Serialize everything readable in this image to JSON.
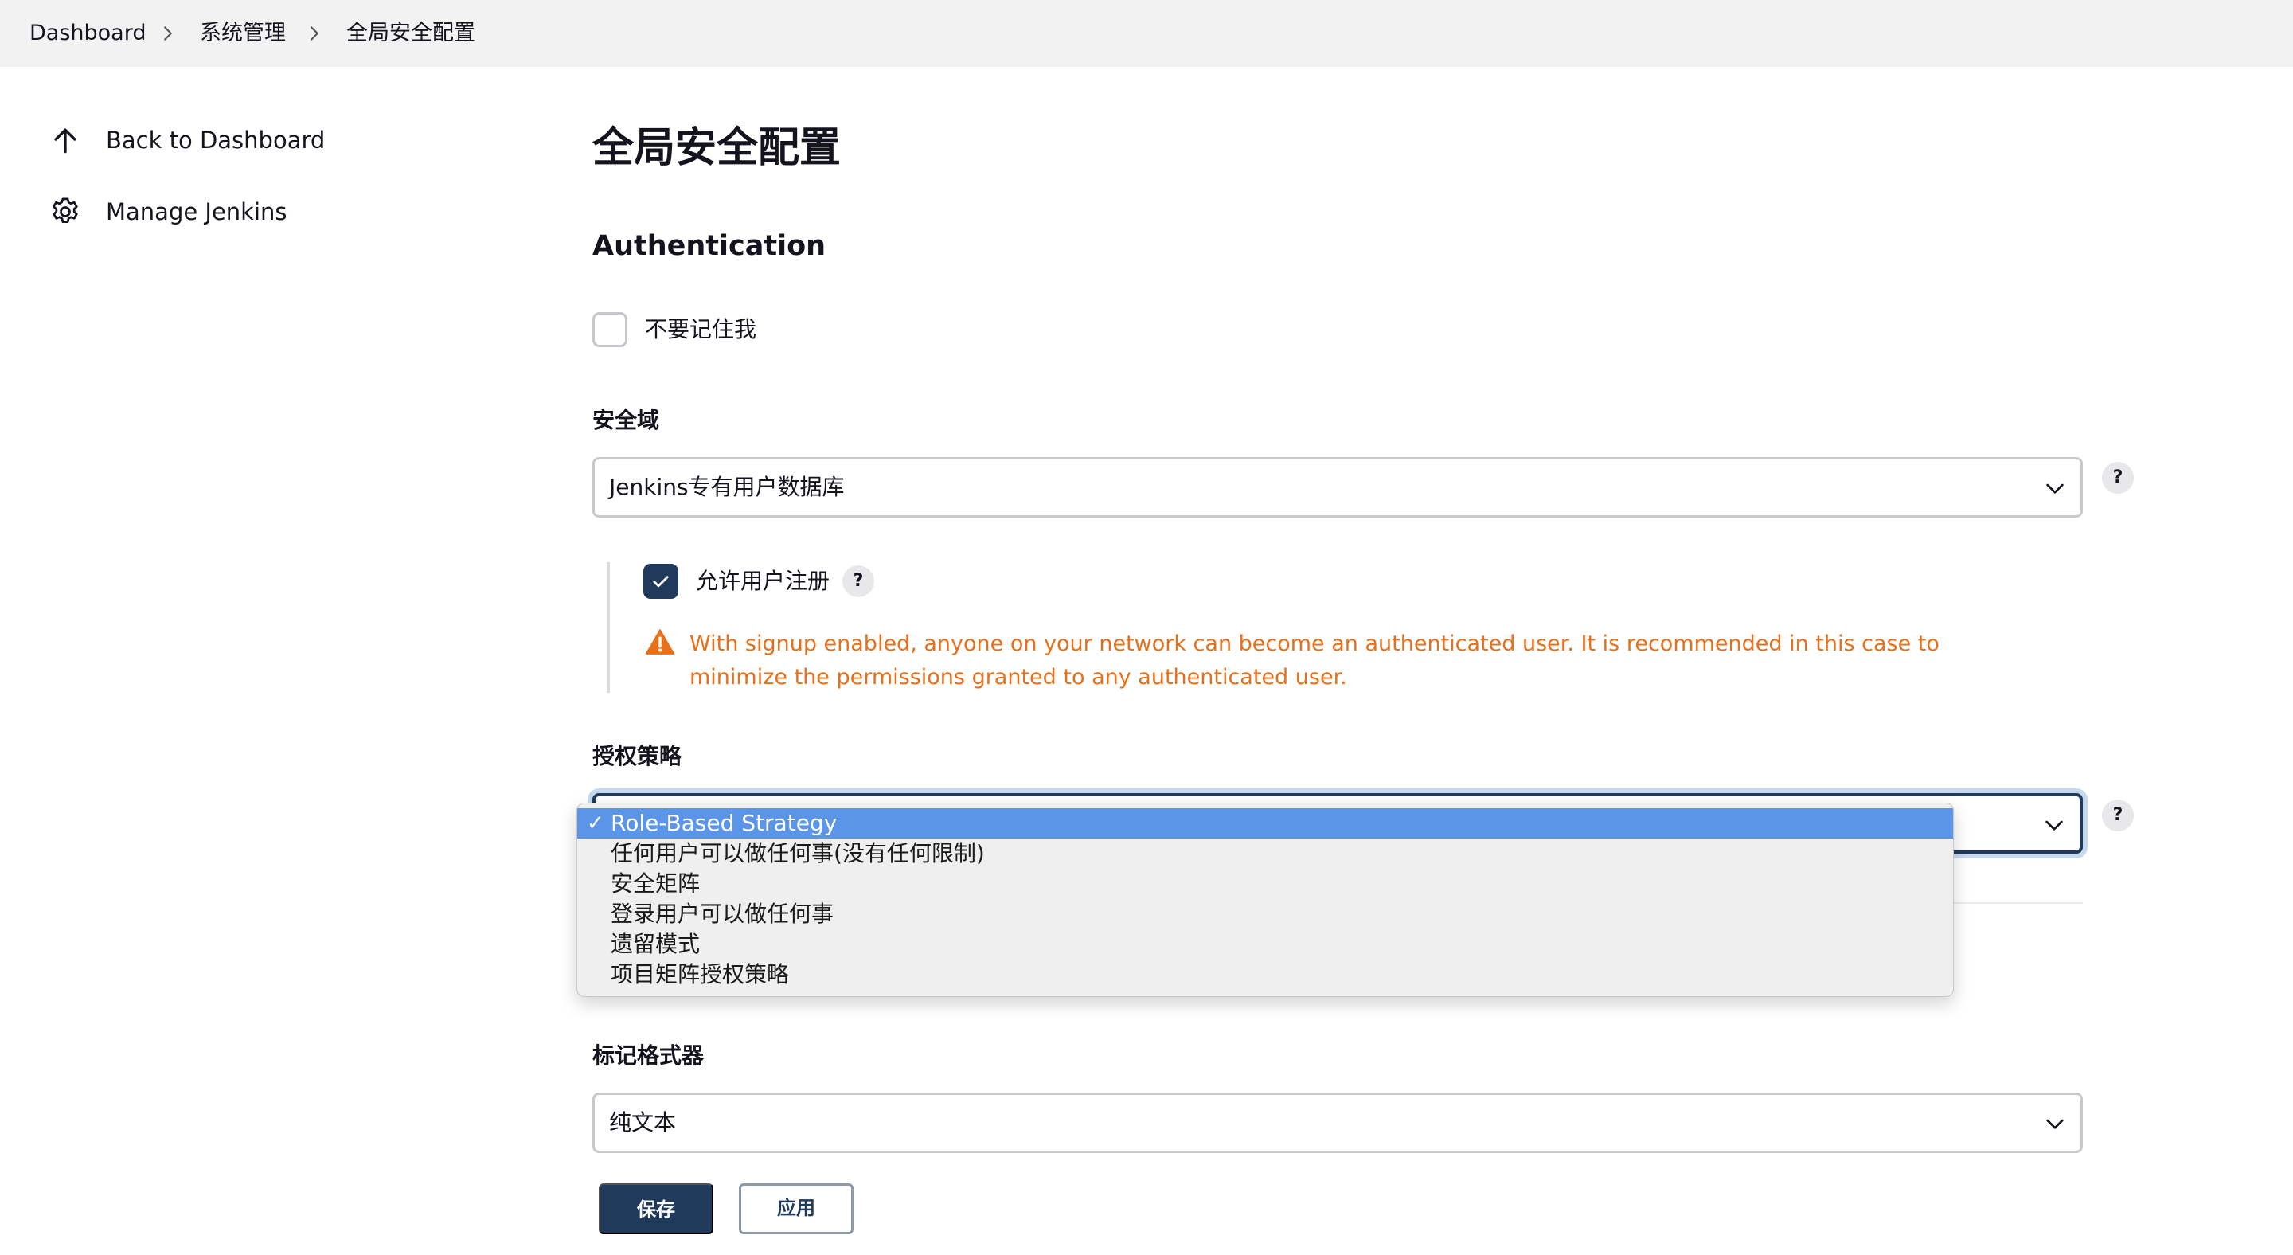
{
  "breadcrumb": {
    "items": [
      "Dashboard",
      "系统管理",
      "全局安全配置"
    ]
  },
  "sidebar": {
    "items": [
      {
        "label": "Back to Dashboard",
        "icon": "arrow-up-icon"
      },
      {
        "label": "Manage Jenkins",
        "icon": "gear-icon"
      }
    ]
  },
  "page": {
    "title": "全局安全配置",
    "section_title": "Authentication"
  },
  "remember_me": {
    "label": "不要记住我",
    "checked": false
  },
  "security_realm": {
    "label": "安全域",
    "value": "Jenkins专有用户数据库",
    "help": "?"
  },
  "allow_signup": {
    "label": "允许用户注册",
    "checked": true,
    "help": "?",
    "warning": "With signup enabled, anyone on your network can become an authenticated user. It is recommended in this case to minimize the permissions granted to any authenticated user."
  },
  "authorization": {
    "label": "授权策略",
    "help": "?",
    "options": [
      "Role-Based Strategy",
      "任何用户可以做任何事(没有任何限制)",
      "安全矩阵",
      "登录用户可以做任何事",
      "遗留模式",
      "项目矩阵授权策略"
    ],
    "selected_mark": "✓"
  },
  "markup_formatter": {
    "label": "标记格式器",
    "value": "纯文本"
  },
  "actions": {
    "save_label": "保存",
    "apply_label": "应用"
  },
  "colors": {
    "primary": "#1f3a5b",
    "warning": "#e8701a",
    "dropdown_highlight": "#5b95e8"
  }
}
